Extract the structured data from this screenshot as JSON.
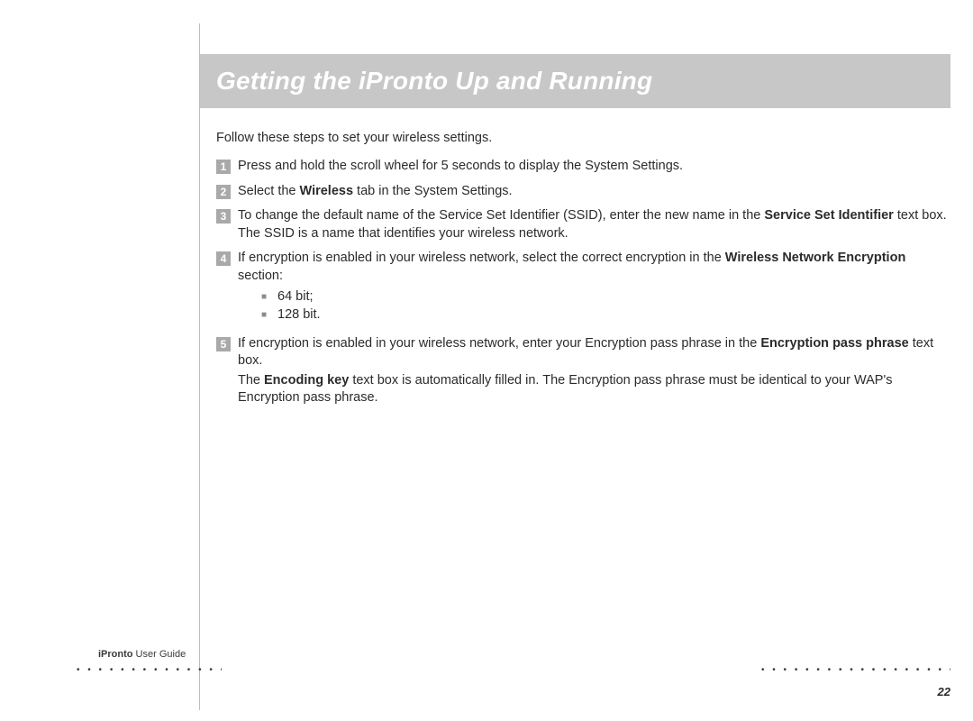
{
  "header": {
    "title": "Getting the iPronto Up and Running"
  },
  "intro": "Follow these steps to set your wireless settings.",
  "steps": [
    {
      "num": "1",
      "body": "Press and hold the scroll wheel for 5 seconds to display the System Settings."
    },
    {
      "num": "2",
      "body_pre": "Select the ",
      "body_b1": "Wireless",
      "body_post": " tab in the System Settings."
    },
    {
      "num": "3",
      "body_pre": "To change the default name of the Service Set Identifier (SSID), enter the new name in the ",
      "body_b1": "Service Set Identifier",
      "body_post": " text box. The SSID is a name that identifies your wireless network."
    },
    {
      "num": "4",
      "body_pre": "If encryption is enabled in your wireless network, select the correct encryption in the ",
      "body_b1": "Wireless Network Encryption",
      "body_post": " section:",
      "bullets": [
        "64 bit;",
        "128 bit."
      ]
    },
    {
      "num": "5",
      "body_pre": "If encryption is enabled in your wireless network, enter your Encryption pass phrase in the ",
      "body_b1": "Encryption pass phrase",
      "body_post": " text box.",
      "note_pre": "The ",
      "note_b": "Encoding key",
      "note_post": " text box is automatically filled in. The Encryption pass phrase must be identical to your WAP's Encryption pass phrase."
    }
  ],
  "footer": {
    "brand": "iPronto",
    "doc": " User Guide",
    "page": "22",
    "dots": "• • • • • • • • • • • • • • • • • • • • • • • • • • • • • • • • • • • • • • • •"
  }
}
